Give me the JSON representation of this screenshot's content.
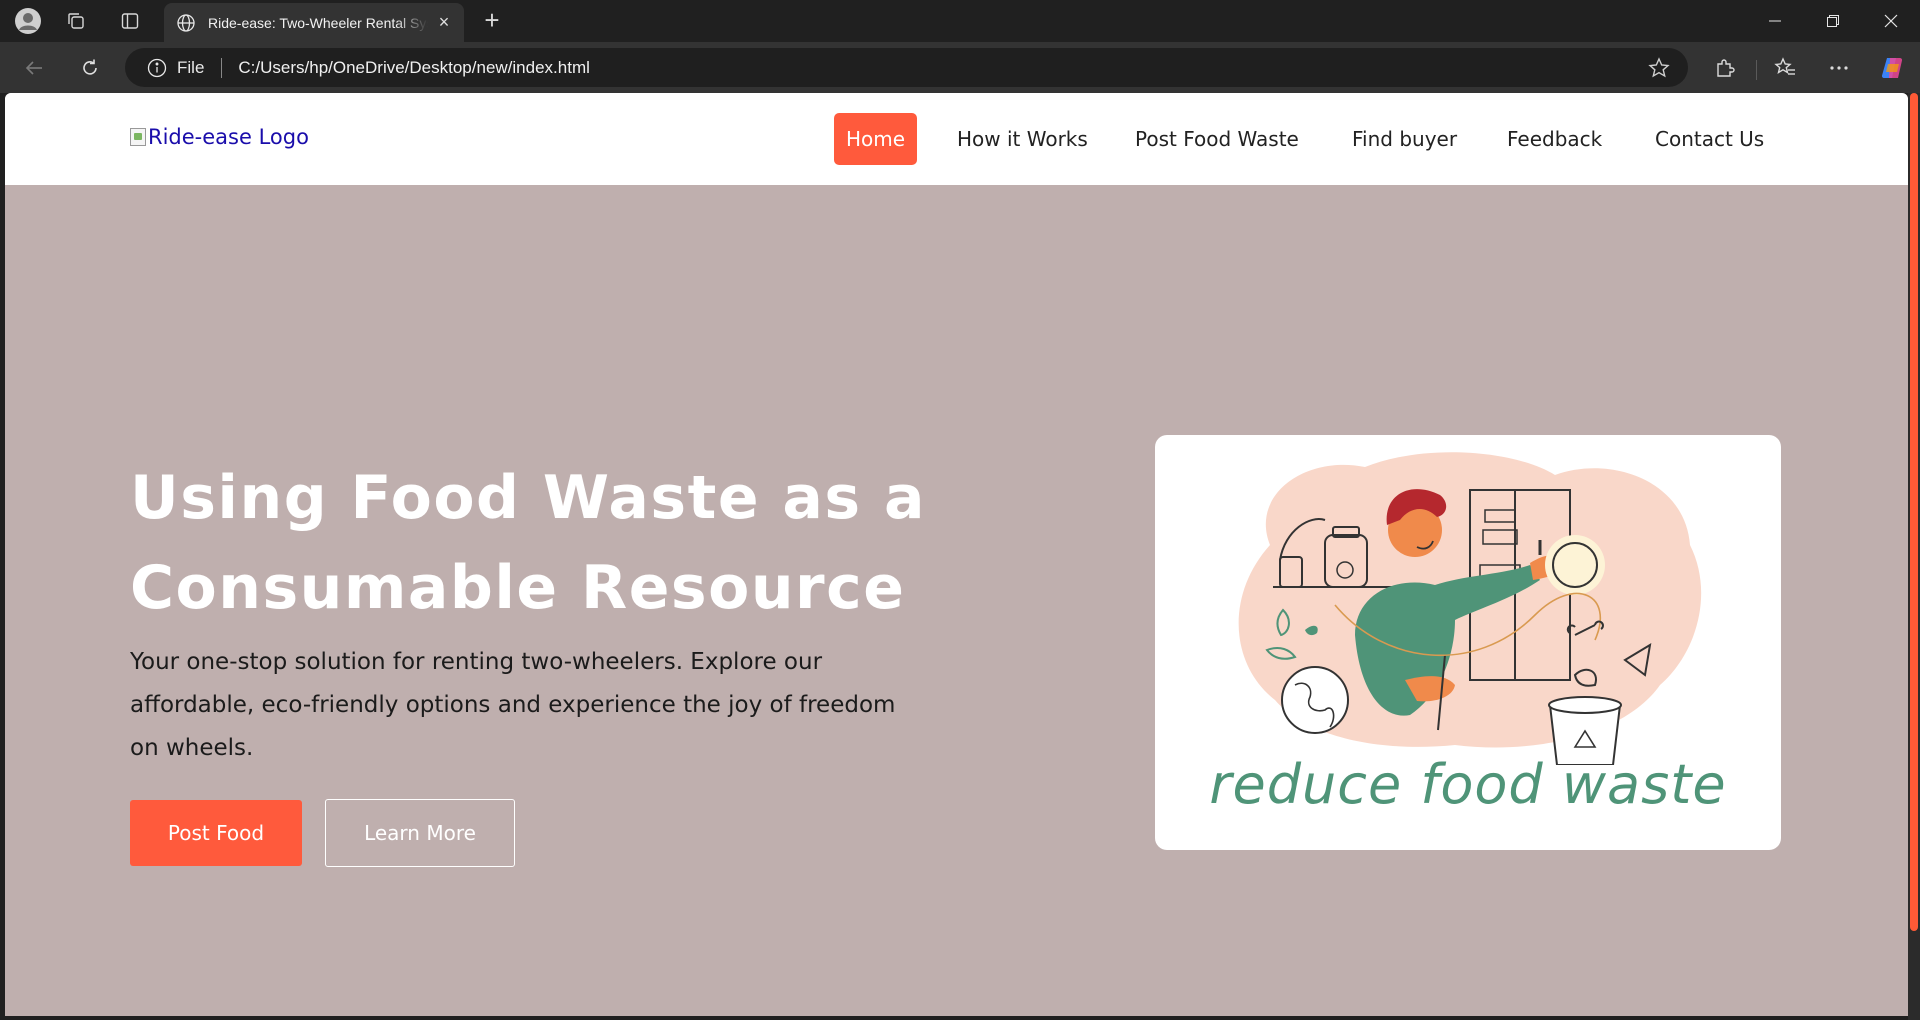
{
  "browser": {
    "tab_title": "Ride-ease: Two-Wheeler Rental System",
    "address_label": "File",
    "url": "C:/Users/hp/OneDrive/Desktop/new/index.html",
    "new_tab_label": "+",
    "close_tab_label": "×"
  },
  "site": {
    "logo_alt": "Ride-ease Logo",
    "nav": [
      {
        "label": "Home",
        "active": true
      },
      {
        "label": "How it Works",
        "active": false
      },
      {
        "label": "Post Food Waste",
        "active": false
      },
      {
        "label": "Find buyer",
        "active": false
      },
      {
        "label": "Feedback",
        "active": false
      },
      {
        "label": "Contact Us",
        "active": false
      }
    ]
  },
  "hero": {
    "title_line1": "Using Food Waste as a",
    "title_line2": "Consumable Resource",
    "description": "Your one-stop solution for renting two-wheelers. Explore our affordable, eco-friendly options and experience the joy of freedom on wheels.",
    "primary_button": "Post Food",
    "secondary_button": "Learn More",
    "image_caption": "reduce food waste"
  },
  "colors": {
    "accent": "#ff5a3c",
    "hero_background": "#bfafae",
    "caption_green": "#4f9478"
  }
}
